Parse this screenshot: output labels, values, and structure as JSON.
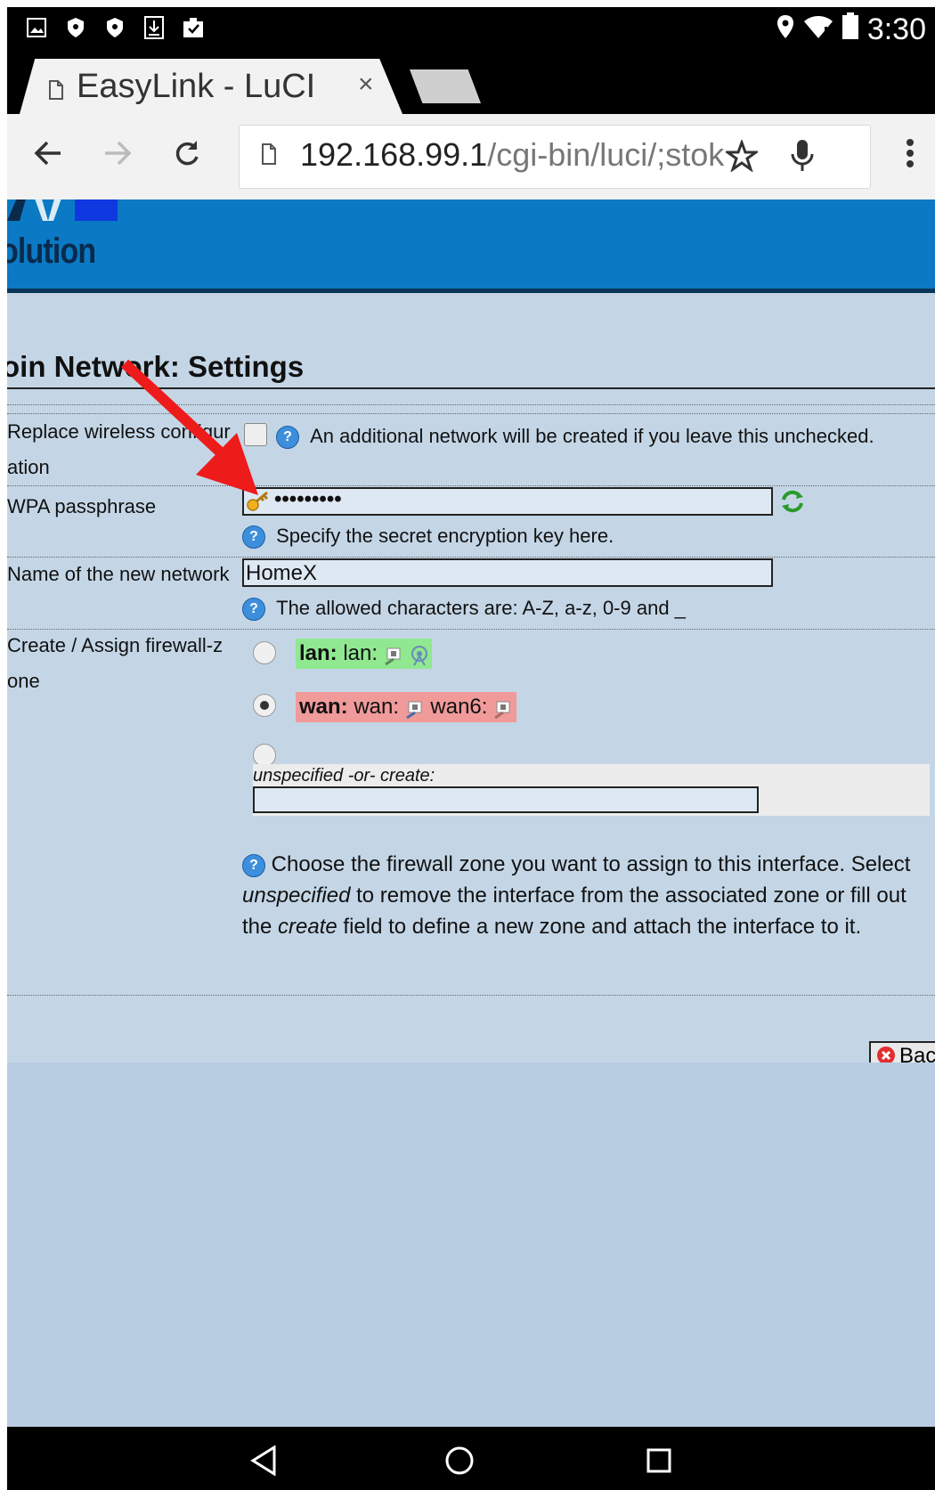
{
  "status": {
    "time": "3:30"
  },
  "browser": {
    "tab_title": "EasyLink - LuCI",
    "tab_close": "×",
    "url_host": "192.168.99.1",
    "url_path": "/cgi-bin/luci/;stok"
  },
  "header": {
    "logo_text": "olution"
  },
  "page": {
    "title": "oin Network: Settings",
    "replace": {
      "label_1": "Replace wireless configur",
      "label_2": "ation",
      "hint": "An additional network will be created if you leave this unchecked."
    },
    "wpa": {
      "label": "WPA passphrase",
      "value": "•••••••••",
      "hint": "Specify the secret encryption key here."
    },
    "name": {
      "label": "Name of the new network",
      "value": "HomeX",
      "hint": "The allowed characters are: A-Z, a-z, 0-9 and _"
    },
    "firewall": {
      "label_1": "Create / Assign firewall-z",
      "label_2": "one",
      "lan_bold": "lan:",
      "lan_text": "lan:",
      "wan_bold": "wan:",
      "wan_text": "wan:",
      "wan6_text": "wan6:",
      "create_label": "unspecified -or- create:",
      "create_value": "",
      "desc_1": "Choose the firewall zone you want to assign to this interface. Select ",
      "desc_em1": "unspecified",
      "desc_2": " to remove the interface from the associated zone or fill out the ",
      "desc_em2": "create",
      "desc_3": " field to define a new zone and attach the interface to it."
    },
    "back_label": "Bac"
  },
  "colors": {
    "header_blue": "#0b79c3",
    "page_bg": "#c4d6e6",
    "lan_zone": "#90e890",
    "wan_zone": "#f09a9a",
    "annotation_arrow": "#ee1b1b"
  }
}
